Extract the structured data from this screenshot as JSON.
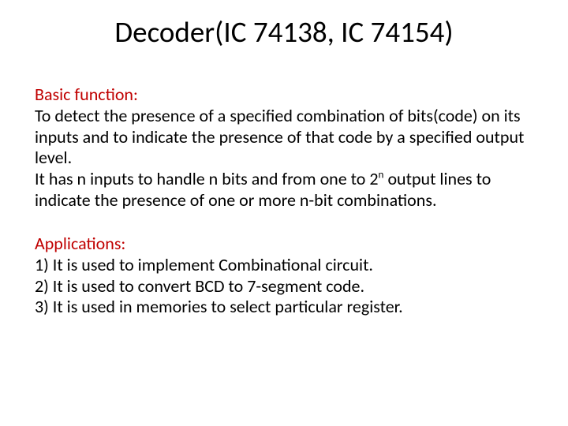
{
  "title": "Decoder(IC 74138, IC 74154)",
  "basic": {
    "heading": "Basic function:",
    "p1": "To detect the presence of a specified combination of bits(code) on its inputs and to indicate the presence of that code by a specified output level.",
    "p2a": "It has n inputs to handle n bits and from one to 2",
    "p2sup": "n",
    "p2b": " output lines to indicate the presence of one or more n-bit combinations."
  },
  "apps": {
    "heading": "Applications:",
    "items": [
      "1) It is used to implement Combinational circuit.",
      "2) It is used to convert BCD to 7-segment code.",
      "3) It is used in memories to select particular register."
    ]
  }
}
